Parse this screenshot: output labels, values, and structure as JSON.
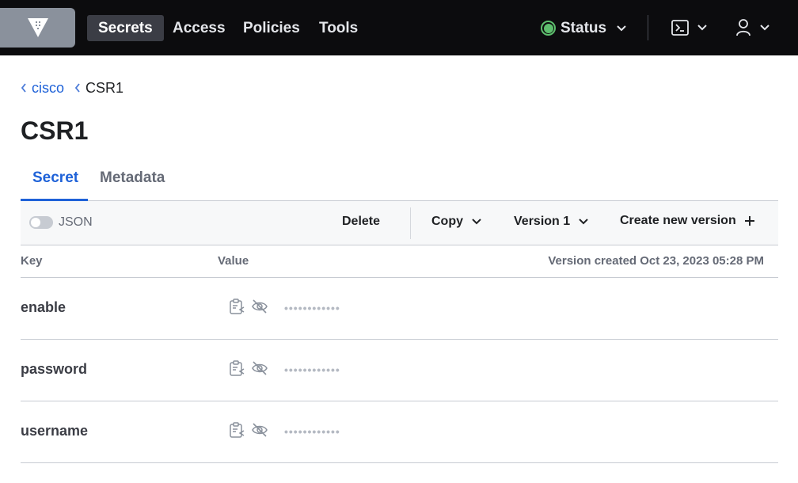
{
  "nav": {
    "items": [
      {
        "label": "Secrets",
        "active": true
      },
      {
        "label": "Access",
        "active": false
      },
      {
        "label": "Policies",
        "active": false
      },
      {
        "label": "Tools",
        "active": false
      }
    ],
    "status_label": "Status",
    "status_color": "#5dbe6d",
    "icons": [
      "vault-logo-icon",
      "console-icon",
      "user-icon"
    ]
  },
  "breadcrumb": {
    "items": [
      "cisco",
      "CSR1"
    ]
  },
  "page_title": "CSR1",
  "tabs": [
    {
      "label": "Secret",
      "active": true
    },
    {
      "label": "Metadata",
      "active": false
    }
  ],
  "toolbar": {
    "json_toggle_label": "JSON",
    "json_toggle_on": false,
    "delete_label": "Delete",
    "copy_label": "Copy",
    "version_label": "Version 1",
    "create_label": "Create new version"
  },
  "table": {
    "key_header": "Key",
    "value_header": "Value",
    "version_created": "Version created Oct 23, 2023 05:28 PM",
    "rows": [
      {
        "key": "enable",
        "value": "••••••••••••"
      },
      {
        "key": "password",
        "value": "••••••••••••"
      },
      {
        "key": "username",
        "value": "••••••••••••"
      }
    ]
  },
  "colors": {
    "topbar": "#0c0c0e",
    "accent": "#1f62d8",
    "status_ok": "#5dbe6d"
  }
}
